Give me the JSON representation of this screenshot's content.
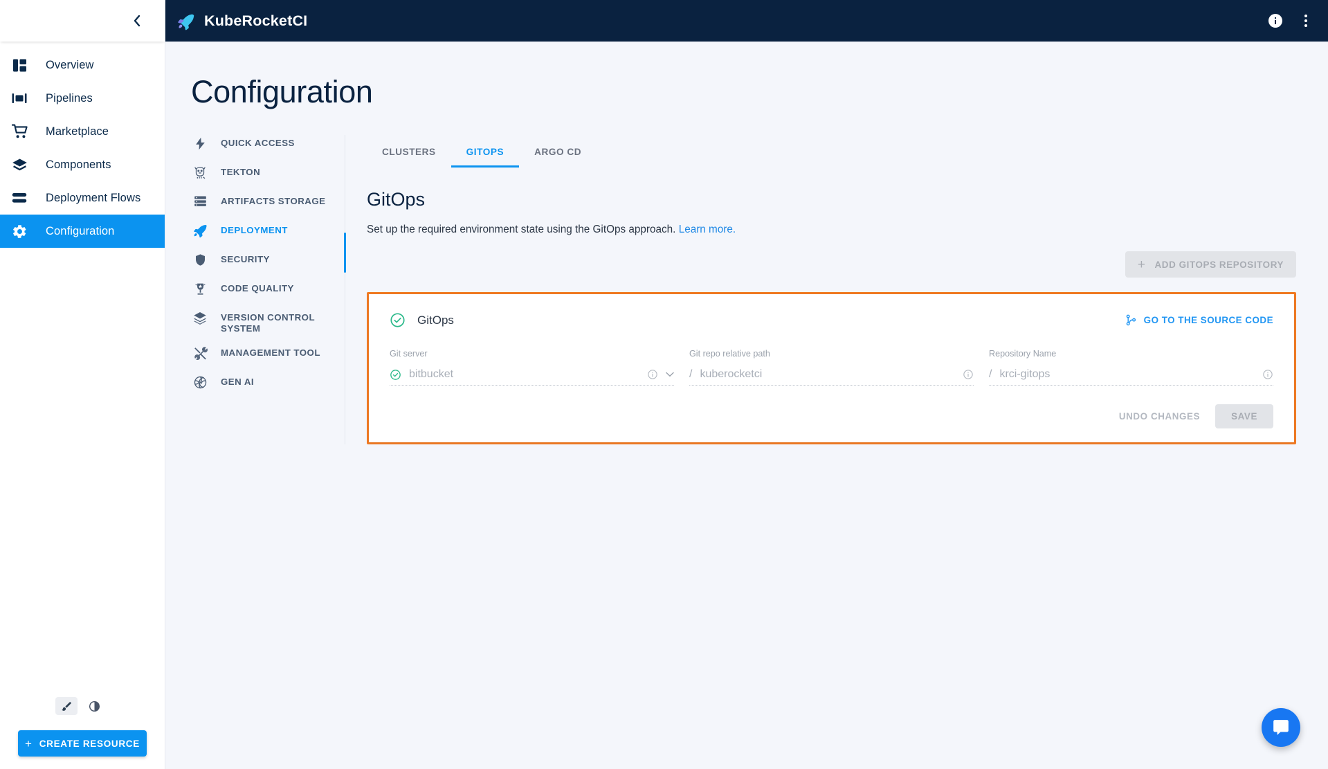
{
  "colors": {
    "accent": "#0b93f0",
    "topbar_bg": "#0a2240",
    "highlight_border": "#f07a22",
    "link": "#1e88e5",
    "success": "#2bb98a",
    "page_bg": "#f4f6fb"
  },
  "topbar": {
    "brand": "KubeRocketCI",
    "logo_icon": "rocket-icon",
    "info_icon": "info-circle-icon",
    "more_icon": "more-vertical-icon"
  },
  "sidebar": {
    "collapse_icon": "chevron-left-icon",
    "items": [
      {
        "label": "Overview",
        "icon": "dashboard-icon",
        "active": false
      },
      {
        "label": "Pipelines",
        "icon": "pipelines-icon",
        "active": false
      },
      {
        "label": "Marketplace",
        "icon": "cart-icon",
        "active": false
      },
      {
        "label": "Components",
        "icon": "layers-icon",
        "active": false
      },
      {
        "label": "Deployment Flows",
        "icon": "flows-icon",
        "active": false
      },
      {
        "label": "Configuration",
        "icon": "gear-icon",
        "active": true
      }
    ],
    "theme_toggles": [
      {
        "icon": "brush-icon",
        "selected": true
      },
      {
        "icon": "contrast-icon",
        "selected": false
      }
    ],
    "create_button": {
      "label": "CREATE RESOURCE",
      "icon": "plus-icon"
    }
  },
  "page": {
    "title": "Configuration"
  },
  "secondary_nav": {
    "items": [
      {
        "label": "QUICK ACCESS",
        "icon": "bolt-icon",
        "active": false
      },
      {
        "label": "TEKTON",
        "icon": "tekton-cat-icon",
        "active": false
      },
      {
        "label": "ARTIFACTS STORAGE",
        "icon": "storage-icon",
        "active": false
      },
      {
        "label": "DEPLOYMENT",
        "icon": "rocket-icon",
        "active": true
      },
      {
        "label": "SECURITY",
        "icon": "shield-icon",
        "active": false
      },
      {
        "label": "CODE QUALITY",
        "icon": "trophy-icon",
        "active": false
      },
      {
        "label": "VERSION CONTROL SYSTEM",
        "icon": "layers-icon",
        "active": false
      },
      {
        "label": "MANAGEMENT TOOL",
        "icon": "tools-icon",
        "active": false
      },
      {
        "label": "GEN AI",
        "icon": "gen-ai-icon",
        "active": false
      }
    ]
  },
  "main": {
    "tabs": [
      {
        "label": "CLUSTERS",
        "active": false
      },
      {
        "label": "GITOPS",
        "active": true
      },
      {
        "label": "ARGO CD",
        "active": false
      }
    ],
    "section": {
      "title": "GitOps",
      "description": "Set up the required environment state using the GitOps approach.",
      "learn_more": "Learn more."
    },
    "add_repository_button": {
      "label": "ADD GITOPS REPOSITORY",
      "icon": "plus-icon",
      "disabled": true
    },
    "card": {
      "status_icon": "check-circle-icon",
      "title": "GitOps",
      "source_code_link": {
        "label": "GO TO THE SOURCE CODE",
        "icon": "git-branch-icon"
      },
      "fields": [
        {
          "label": "Git server",
          "value": "bitbucket",
          "prefix": "",
          "leading_icon": "check-circle-icon",
          "info_icon": "info-circle-icon",
          "dropdown_icon": "chevron-down-icon",
          "disabled": true
        },
        {
          "label": "Git repo relative path",
          "value": "kuberocketci",
          "prefix": "/",
          "leading_icon": "",
          "info_icon": "info-circle-icon",
          "dropdown_icon": "",
          "disabled": true
        },
        {
          "label": "Repository Name",
          "value": "krci-gitops",
          "prefix": "/",
          "leading_icon": "",
          "info_icon": "info-circle-icon",
          "dropdown_icon": "",
          "disabled": true
        }
      ],
      "undo_button": {
        "label": "UNDO CHANGES",
        "disabled": true
      },
      "save_button": {
        "label": "SAVE",
        "disabled": true
      }
    }
  },
  "chat_fab": {
    "icon": "chat-icon"
  }
}
